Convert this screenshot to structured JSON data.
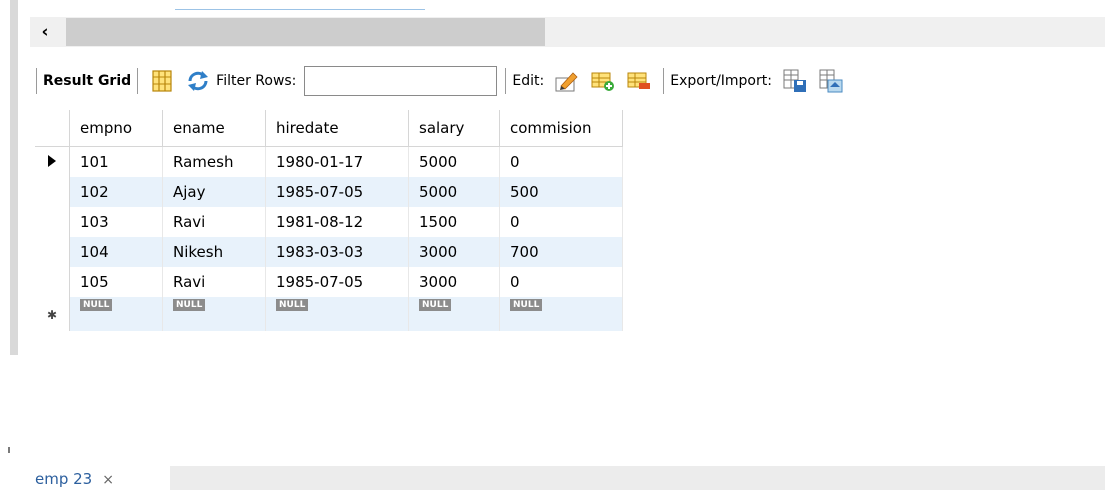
{
  "toolbar": {
    "result_grid_label": "Result Grid",
    "filter_rows_label": "Filter Rows:",
    "filter_rows_value": "",
    "edit_label": "Edit:",
    "export_import_label": "Export/Import:"
  },
  "icons": {
    "scroll_left": "‹",
    "form_editor": "grid-form-icon",
    "wrap_cells": "refresh-icon",
    "edit_row": "edit-pencil-icon",
    "add_row": "add-row-icon",
    "delete_row": "delete-row-icon",
    "export": "export-icon",
    "import": "import-icon"
  },
  "grid": {
    "columns": [
      "empno",
      "ename",
      "hiredate",
      "salary",
      "commision"
    ],
    "rows": [
      [
        "101",
        "Ramesh",
        "1980-01-17",
        "5000",
        "0"
      ],
      [
        "102",
        "Ajay",
        "1985-07-05",
        "5000",
        "500"
      ],
      [
        "103",
        "Ravi",
        "1981-08-12",
        "1500",
        "0"
      ],
      [
        "104",
        "Nikesh",
        "1983-03-03",
        "3000",
        "700"
      ],
      [
        "105",
        "Ravi",
        "1985-07-05",
        "3000",
        "0"
      ]
    ],
    "null_label": "NULL",
    "new_row_marker": "✱"
  },
  "tabs": [
    {
      "label": "emp 23",
      "close": "×"
    }
  ],
  "colors": {
    "alt_row": "#e8f2fb",
    "null_badge": "#8c8c8c",
    "tab_text": "#2c5f9e"
  }
}
